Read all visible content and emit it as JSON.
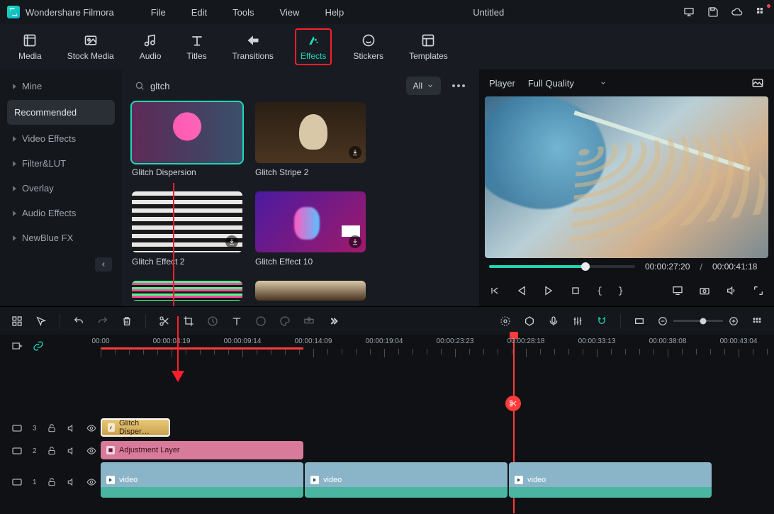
{
  "app": {
    "name": "Wondershare Filmora",
    "doc_title": "Untitled"
  },
  "menu": {
    "file": "File",
    "edit": "Edit",
    "tools": "Tools",
    "view": "View",
    "help": "Help"
  },
  "tooltabs": {
    "media": "Media",
    "stock": "Stock Media",
    "audio": "Audio",
    "titles": "Titles",
    "transitions": "Transitions",
    "effects": "Effects",
    "stickers": "Stickers",
    "templates": "Templates"
  },
  "sidebar": {
    "items": [
      {
        "label": "Mine"
      },
      {
        "label": "Recommended"
      },
      {
        "label": "Video Effects"
      },
      {
        "label": "Filter&LUT"
      },
      {
        "label": "Overlay"
      },
      {
        "label": "Audio Effects"
      },
      {
        "label": "NewBlue FX"
      }
    ]
  },
  "search": {
    "value": "gltch",
    "filter": "All"
  },
  "effects": [
    {
      "label": "Glitch Dispersion"
    },
    {
      "label": "Glitch Stripe 2"
    },
    {
      "label": "Glitch Effect 2"
    },
    {
      "label": "Glitch Effect 10"
    }
  ],
  "preview": {
    "tab": "Player",
    "quality": "Full Quality",
    "time_current": "00:00:27:20",
    "time_total": "00:00:41:18"
  },
  "ruler": {
    "labels": [
      "00:00",
      "00:00:04:19",
      "00:00:09:14",
      "00:00:14:09",
      "00:00:19:04",
      "00:00:23:23",
      "00:00:28:18",
      "00:00:33:13",
      "00:00:38:08",
      "00:00:43:04"
    ]
  },
  "tracks": {
    "t3": "3",
    "t2": "2",
    "t1": "1",
    "clip_effect": "Glitch Disper…",
    "clip_adjust": "Adjustment Layer",
    "clip_video": "video"
  }
}
